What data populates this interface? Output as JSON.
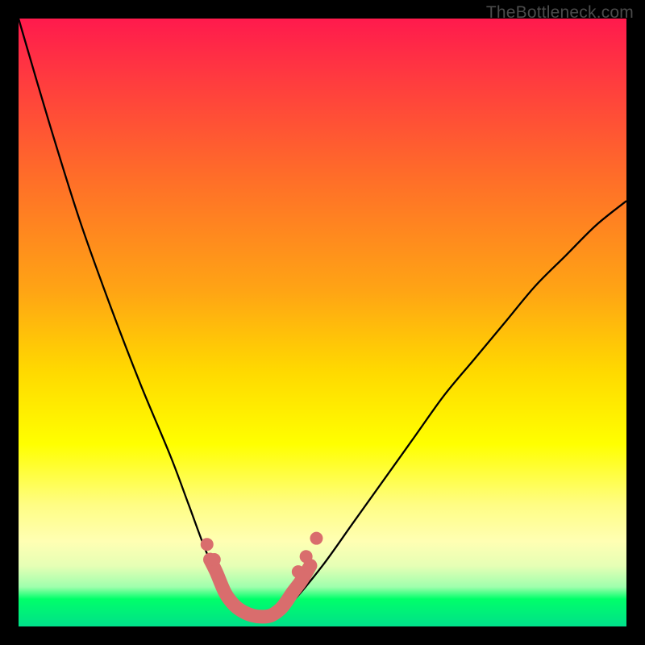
{
  "watermark": "TheBottleneck.com",
  "chart_data": {
    "type": "line",
    "title": "",
    "xlabel": "",
    "ylabel": "",
    "xlim": [
      0,
      100
    ],
    "ylim": [
      0,
      100
    ],
    "series": [
      {
        "name": "bottleneck-curve",
        "x": [
          0,
          5,
          10,
          15,
          20,
          25,
          28,
          31,
          34,
          36,
          38,
          40,
          42,
          45,
          50,
          55,
          60,
          65,
          70,
          75,
          80,
          85,
          90,
          95,
          100
        ],
        "y": [
          100,
          83,
          67,
          53,
          40,
          28,
          20,
          12,
          6,
          3,
          1.5,
          1,
          1.5,
          4,
          10,
          17,
          24,
          31,
          38,
          44,
          50,
          56,
          61,
          66,
          70
        ]
      },
      {
        "name": "overlay-dots",
        "x": [
          31.5,
          32.5,
          34,
          35.5,
          37,
          38.5,
          40,
          41.5,
          43,
          44,
          45,
          46.5,
          48
        ],
        "y": [
          11,
          9,
          5.5,
          3.5,
          2.4,
          1.8,
          1.6,
          1.8,
          2.8,
          4,
          5.5,
          7.5,
          10
        ]
      }
    ],
    "gradient_bands": [
      {
        "pos": 0.0,
        "color": "#ff1a4d"
      },
      {
        "pos": 0.45,
        "color": "#ffa514"
      },
      {
        "pos": 0.7,
        "color": "#ffff00"
      },
      {
        "pos": 0.95,
        "color": "#00ff6a"
      }
    ]
  }
}
